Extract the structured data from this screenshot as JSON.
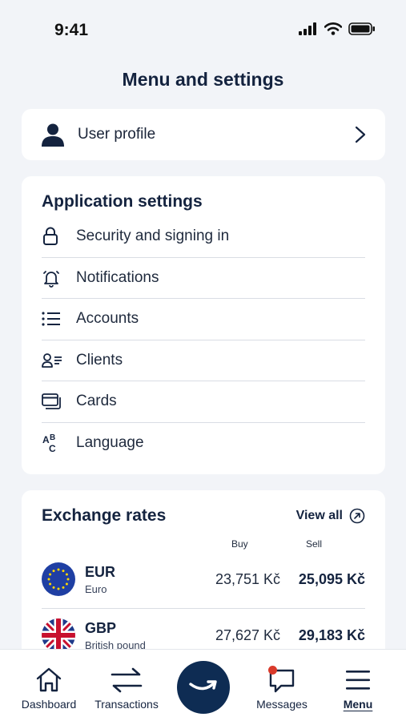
{
  "status": {
    "time": "9:41"
  },
  "title": "Menu and settings",
  "profile": {
    "label": "User profile"
  },
  "settings": {
    "title": "Application settings",
    "items": [
      {
        "label": "Security and signing in",
        "icon": "lock-icon"
      },
      {
        "label": "Notifications",
        "icon": "bell-icon"
      },
      {
        "label": "Accounts",
        "icon": "list-icon"
      },
      {
        "label": "Clients",
        "icon": "clients-icon"
      },
      {
        "label": "Cards",
        "icon": "cards-icon"
      },
      {
        "label": "Language",
        "icon": "language-icon"
      }
    ]
  },
  "rates": {
    "title": "Exchange rates",
    "view_all": "View all",
    "buy_label": "Buy",
    "sell_label": "Sell",
    "rows": [
      {
        "code": "EUR",
        "name": "Euro",
        "buy": "23,751 Kč",
        "sell": "25,095 Kč"
      },
      {
        "code": "GBP",
        "name": "British pound",
        "buy": "27,627 Kč",
        "sell": "29,183 Kč"
      }
    ]
  },
  "tabs": {
    "dashboard": "Dashboard",
    "transactions": "Transactions",
    "messages": "Messages",
    "menu": "Menu"
  },
  "colors": {
    "primary": "#0e2c53",
    "badge": "#d93a2b",
    "background": "#f2f4f8"
  }
}
